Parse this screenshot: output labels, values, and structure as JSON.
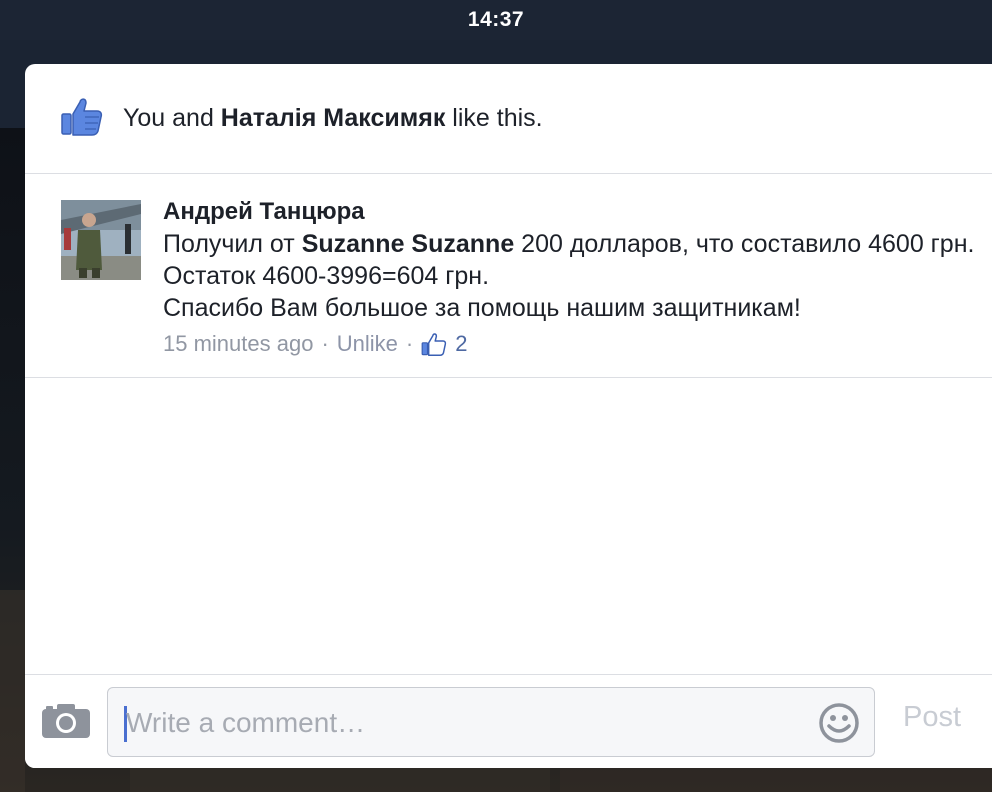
{
  "status_bar": {
    "time": "14:37"
  },
  "likes": {
    "prefix": "You and ",
    "name": "Наталія Максимяк",
    "suffix": " like this."
  },
  "comment": {
    "author": "Андрей Танцюра",
    "text_before": "Получил от ",
    "mention": "Suzanne Suzanne",
    "text_after": " 200 долларов, что составило 4600 грн. Остаток 4600-3996=604 грн.",
    "text_line3": "Спасибо Вам большое за помощь нашим защитникам!",
    "time": "15 minutes ago",
    "separator": "·",
    "unlike_label": "Unlike",
    "like_count": "2"
  },
  "composer": {
    "placeholder": "Write a comment…",
    "post_label": "Post"
  },
  "icons": {
    "like": "thumbs-up-icon",
    "camera": "camera-icon",
    "smiley": "smiley-icon"
  },
  "colors": {
    "accent_blue": "#4a6fd0",
    "text": "#1d2129",
    "meta_gray": "#9197a3",
    "like_count_blue": "#4e69a2"
  }
}
